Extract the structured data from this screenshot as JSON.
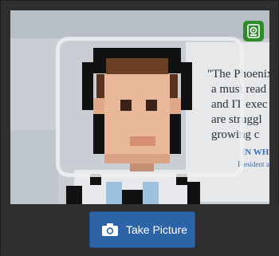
{
  "viewport": {
    "poster": {
      "quote_lines": [
        "\"The Phoenix",
        "a must read",
        "and IT exec",
        "are struggl",
        "growing c"
      ],
      "author": "IN WHITEH",
      "author_title": "President and"
    }
  },
  "controls": {
    "switch_camera_icon": "camera-switch-icon",
    "take_picture_label": "Take Picture",
    "take_picture_icon": "camera-icon"
  },
  "colors": {
    "accent_button": "#2d64a7",
    "switch_button": "#2e8a2a",
    "bar_background": "#2f2f2f"
  }
}
